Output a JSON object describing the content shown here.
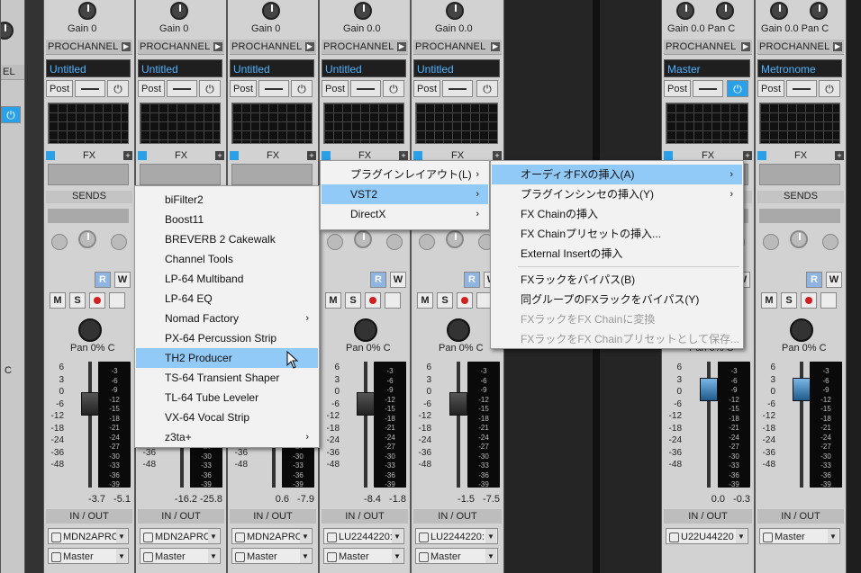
{
  "strips": [
    {
      "id": "s0",
      "gain": "",
      "pan_label": "",
      "name": "",
      "level": [
        "",
        ""
      ]
    },
    {
      "id": "s1",
      "gain": "Gain  0",
      "name": "Untitled",
      "pan": "Pan  0% C",
      "level": [
        "-3.7",
        "-5.1"
      ],
      "io_in": "MDN2APRO",
      "io_out": "Master"
    },
    {
      "id": "s2",
      "gain": "Gain  0",
      "name": "Untitled",
      "pan": "Pan  0% C",
      "level": [
        "-16.2",
        "-25.8"
      ],
      "io_in": "MDN2APRO",
      "io_out": "Master"
    },
    {
      "id": "s3",
      "gain": "Gain  0",
      "name": "Untitled",
      "pan": "Pan  0% C",
      "level": [
        "0.6",
        "-7.9"
      ],
      "io_in": "MDN2APRO",
      "io_out": "Master"
    },
    {
      "id": "s4",
      "gain": "Gain  0.0",
      "name": "Untitled",
      "pan": "Pan  0% C",
      "level": [
        "-8.4",
        "-1.8"
      ],
      "io_in": "LU2244220:",
      "io_out": "Master"
    },
    {
      "id": "s5",
      "gain": "Gain  0.0",
      "name": "Untitled",
      "pan": "Pan  0% C",
      "level": [
        "-1.5",
        "-7.5"
      ],
      "io_in": "LU2244220:",
      "io_out": "Master"
    },
    {
      "id": "s6",
      "gain": "Gain 0.0  Pan  C",
      "name": "Master",
      "pan": "Pan  0% C",
      "level": [
        "0.0",
        "-0.3"
      ],
      "io_in": "U22U44220",
      "io_out": ""
    },
    {
      "id": "s7",
      "gain": "Gain 0.0  Pan  C",
      "name": "Metronome",
      "pan": "Pan  0% C",
      "level": [
        "",
        ""
      ],
      "io_in": "Master",
      "io_out": ""
    }
  ],
  "labels": {
    "prochannel": "PROCHANNEL",
    "post": "Post",
    "fx": "FX",
    "sends": "SENDS",
    "io": "IN / OUT",
    "power": "⏻",
    "r": "R",
    "w": "W",
    "m": "M",
    "s": "S",
    "pan_cut": "C",
    "n_cut": "N",
    "el_cut": "EL"
  },
  "fader_scale": [
    "6",
    "3",
    "0",
    "-6",
    "-12",
    "-18",
    "-24",
    "-36",
    "-48"
  ],
  "meter_scale": [
    "-3",
    "-6",
    "-9",
    "-12",
    "-15",
    "-18",
    "-21",
    "-24",
    "-27",
    "-30",
    "-33",
    "-36",
    "-39"
  ],
  "menu_plugins": {
    "items": [
      {
        "label": "biFilter2",
        "sub": false
      },
      {
        "label": "Boost11",
        "sub": false
      },
      {
        "label": "BREVERB 2 Cakewalk",
        "sub": false
      },
      {
        "label": "Channel Tools",
        "sub": false
      },
      {
        "label": "LP-64 Multiband",
        "sub": false
      },
      {
        "label": "LP-64 EQ",
        "sub": false
      },
      {
        "label": "Nomad Factory",
        "sub": true
      },
      {
        "label": "PX-64 Percussion Strip",
        "sub": false
      },
      {
        "label": "TH2 Producer",
        "sub": false,
        "highlight": true
      },
      {
        "label": "TS-64 Transient Shaper",
        "sub": false
      },
      {
        "label": "TL-64 Tube Leveler",
        "sub": false
      },
      {
        "label": "VX-64 Vocal Strip",
        "sub": false
      },
      {
        "label": "z3ta+",
        "sub": true
      }
    ]
  },
  "menu_layout": {
    "items": [
      {
        "label": "プラグインレイアウト(L)",
        "sub": true
      },
      {
        "label": "VST2",
        "sub": true,
        "highlight": true
      },
      {
        "label": "DirectX",
        "sub": true
      }
    ]
  },
  "menu_insert": {
    "items": [
      {
        "label": "オーディオFXの挿入(A)",
        "sub": true,
        "highlight": true
      },
      {
        "label": "プラグインシンセの挿入(Y)",
        "sub": true
      },
      {
        "label": "FX Chainの挿入",
        "sub": false
      },
      {
        "label": "FX Chainプリセットの挿入...",
        "sub": false
      },
      {
        "label": "External Insertの挿入",
        "sub": false
      },
      {
        "label": "FXラックをバイパス(B)",
        "sub": false
      },
      {
        "label": "同グループのFXラックをバイパス(Y)",
        "sub": false
      },
      {
        "label": "FXラックをFX Chainに変換",
        "sub": false,
        "disabled": true
      },
      {
        "label": "FXラックをFX Chainプリセットとして保存...",
        "sub": false,
        "disabled": true
      }
    ]
  },
  "submenu_arrow": "›"
}
